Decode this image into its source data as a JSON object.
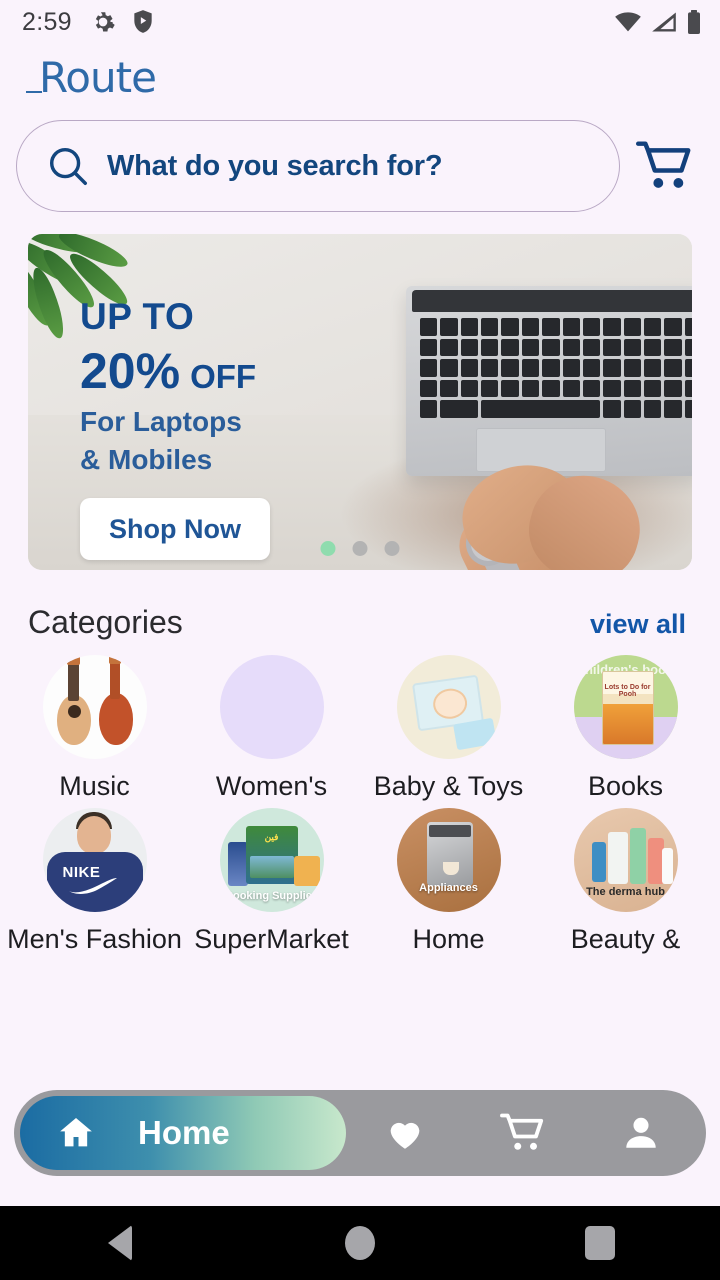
{
  "status_bar": {
    "time": "2:59",
    "left_icons": [
      "gear-icon",
      "shield-play-icon"
    ],
    "right_icons": [
      "wifi-icon",
      "cell-signal-icon",
      "battery-icon"
    ]
  },
  "header": {
    "logo_text": "Route",
    "logo_color": "#2f6aa8"
  },
  "search": {
    "placeholder": "What do you search for?",
    "value": "",
    "icon": "search-icon",
    "cart_icon": "shopping-cart-icon",
    "text_color": "#13467e"
  },
  "banner": {
    "line1": "UP TO",
    "discount": "20%",
    "off": "OFF",
    "line3": "For Laptops",
    "line4": "& Mobiles",
    "cta": "Shop Now",
    "text_color": "#134a8e",
    "dots": [
      {
        "active": true,
        "color": "#8fdcae"
      },
      {
        "active": false,
        "color": "#b3b3b3"
      },
      {
        "active": false,
        "color": "#b3b3b3"
      }
    ]
  },
  "categories_section": {
    "title": "Categories",
    "view_all": "view all",
    "view_all_color": "#1356a8",
    "items": [
      {
        "label": "Music",
        "art": "guitars",
        "caption": ""
      },
      {
        "label": "Women's",
        "art": "placeholder",
        "caption": ""
      },
      {
        "label": "Baby & Toys",
        "art": "diaper-package",
        "caption": ""
      },
      {
        "label": "Books",
        "art": "pooh-book",
        "caption": "children's book",
        "book_title": "Lots to Do for Pooh"
      },
      {
        "label": "Men's Fashion",
        "art": "nike-hoodie",
        "caption": "NIKE"
      },
      {
        "label": "SuperMarket",
        "art": "grocery",
        "caption": "Cooking Supplies"
      },
      {
        "label": "Home",
        "art": "coffee-machine",
        "caption": "Appliances"
      },
      {
        "label": "Beauty &",
        "art": "skincare",
        "caption": "The derma hub"
      }
    ]
  },
  "bottom_nav": {
    "active_label": "Home",
    "active_gradient": [
      "#1b6ca3",
      "#c8e8cc"
    ],
    "bar_color": "#9a9a9e",
    "items": [
      {
        "name": "home",
        "icon": "home-icon",
        "label": "Home",
        "active": true
      },
      {
        "name": "favorites",
        "icon": "heart-icon",
        "label": "",
        "active": false
      },
      {
        "name": "cart",
        "icon": "cart-icon",
        "label": "",
        "active": false
      },
      {
        "name": "profile",
        "icon": "person-icon",
        "label": "",
        "active": false
      }
    ]
  },
  "system_nav": {
    "back": "back-button",
    "home": "home-button",
    "recents": "recents-button"
  }
}
